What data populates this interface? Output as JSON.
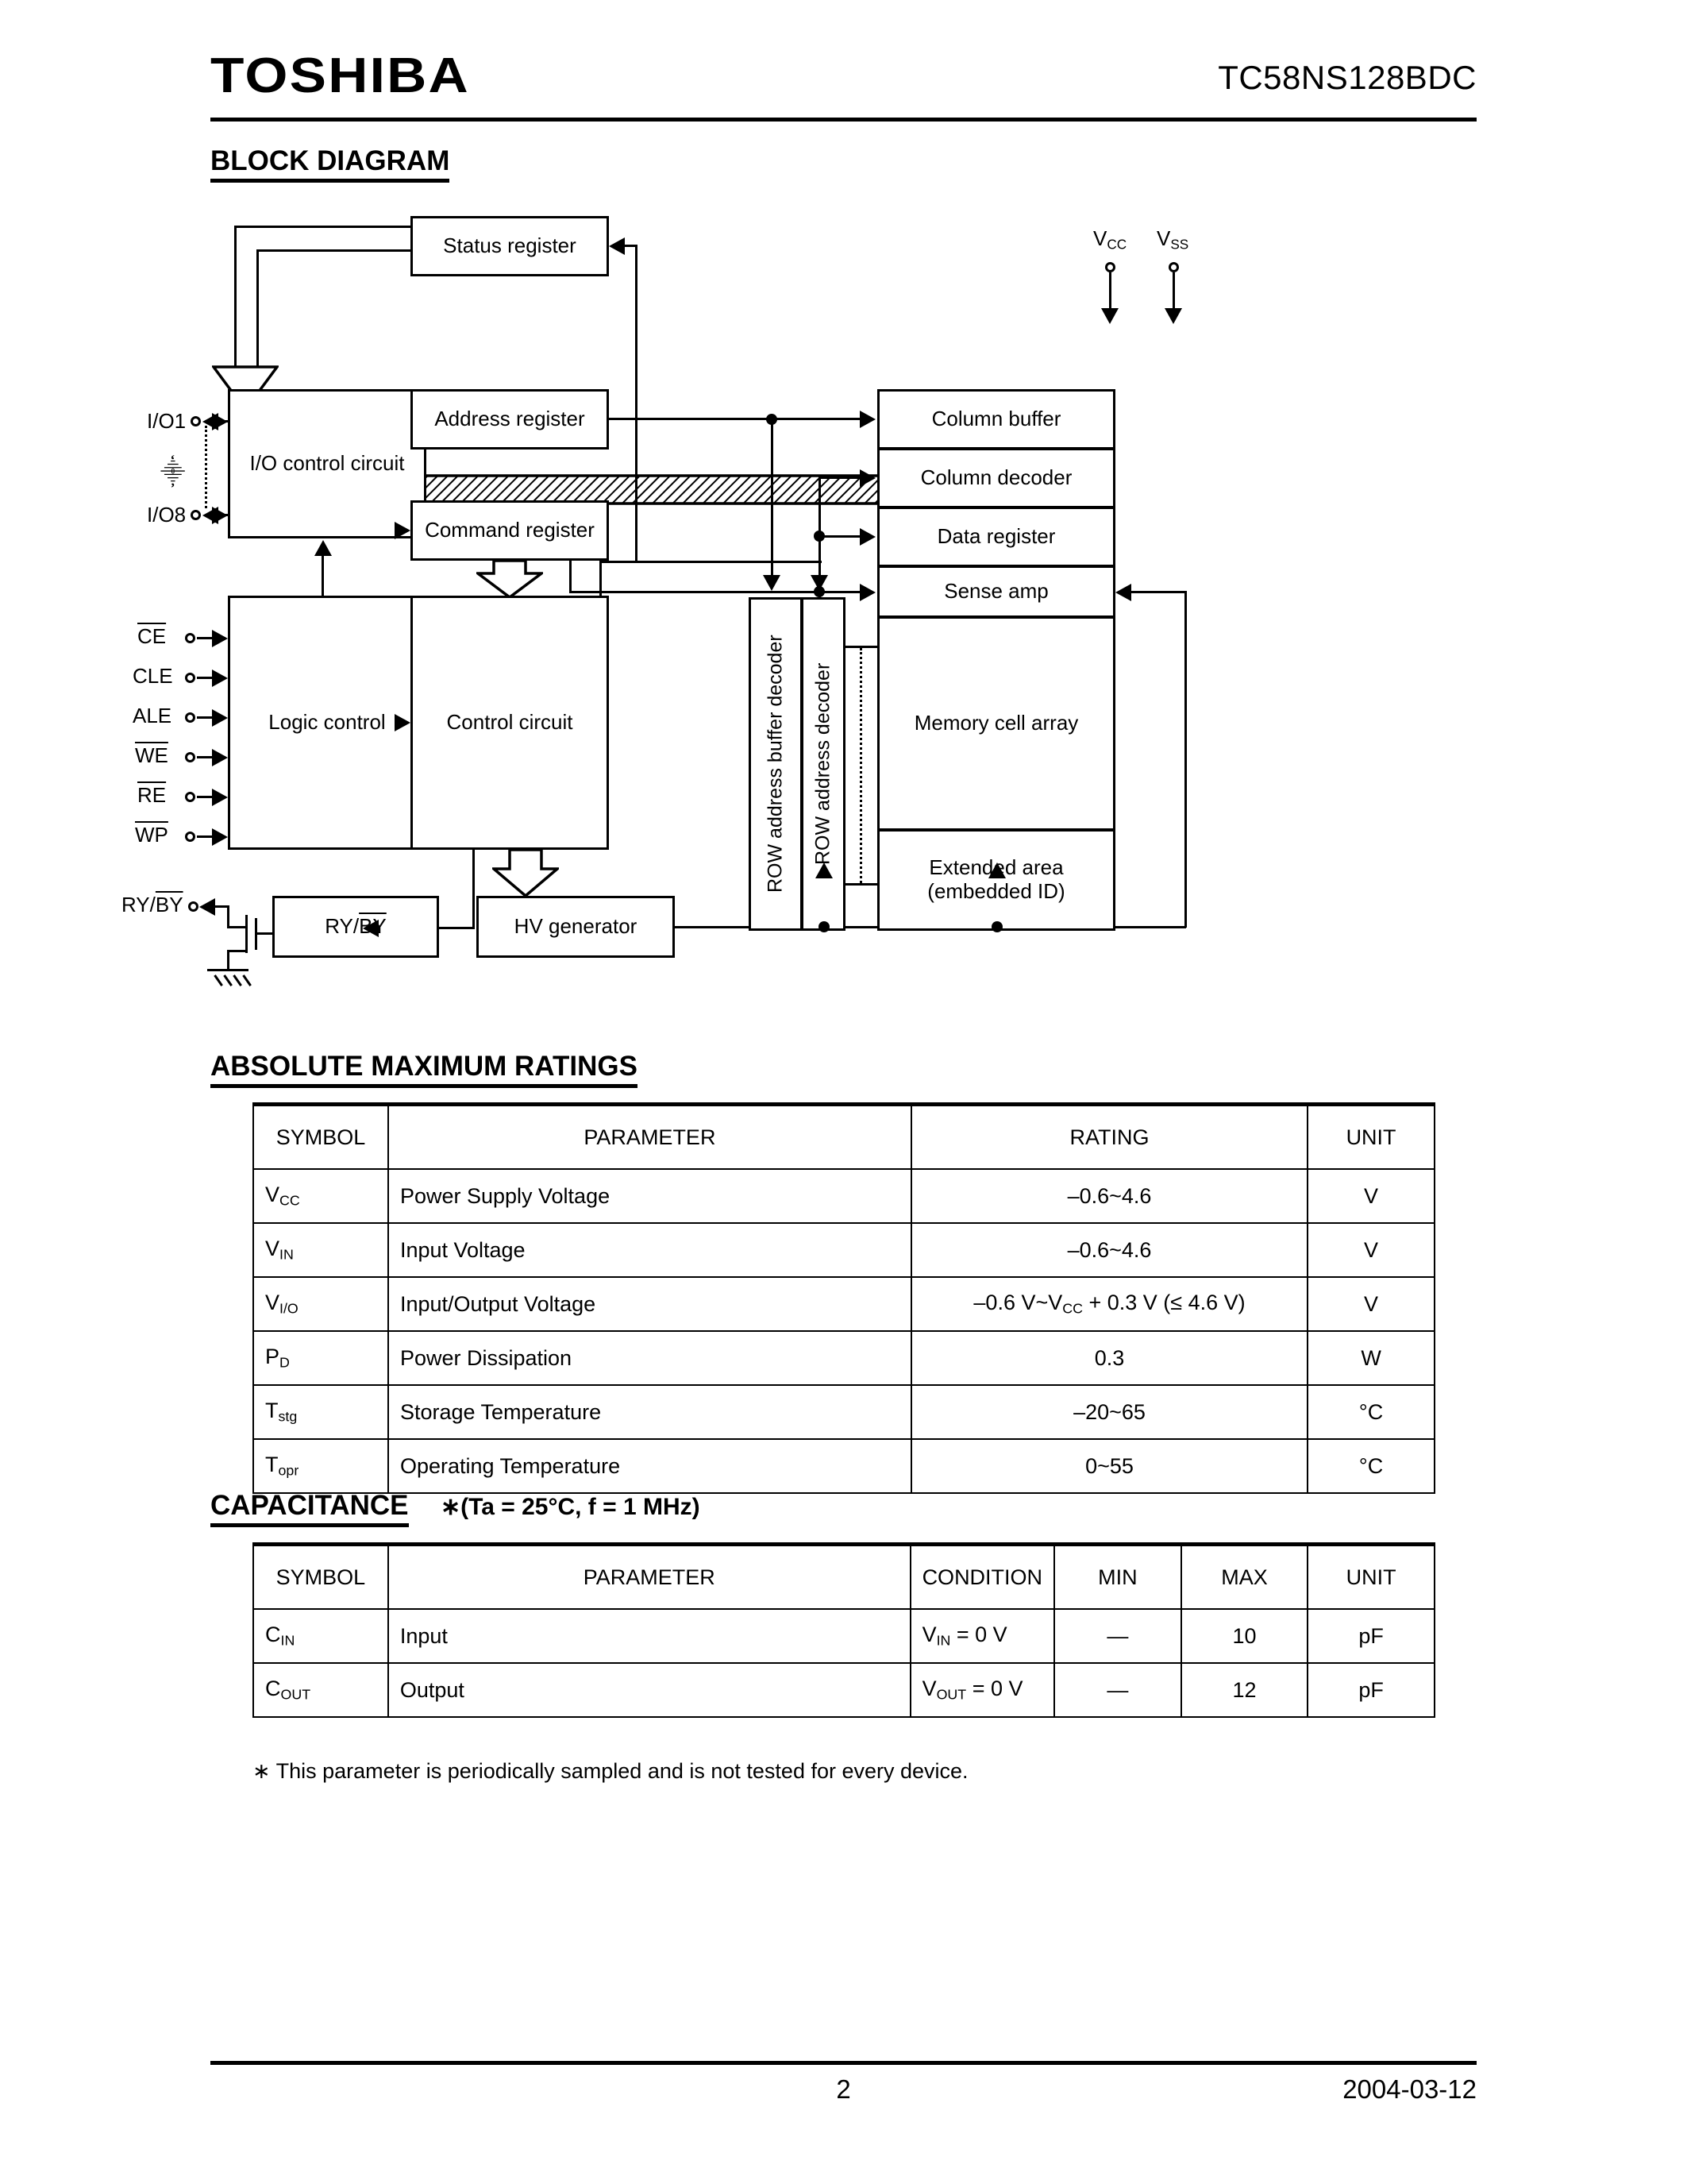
{
  "header": {
    "logo": "TOSHIBA",
    "part_number": "TC58NS128BDC"
  },
  "sections": {
    "block_diagram_title": "BLOCK DIAGRAM",
    "abs_max_title": "ABSOLUTE MAXIMUM RATINGS",
    "capacitance_title": "CAPACITANCE",
    "capacitance_note": "∗(Ta = 25°C, f = 1 MHz)"
  },
  "block_diagram": {
    "blocks": {
      "status_register": "Status register",
      "address_register": "Address register",
      "command_register": "Command register",
      "io_control_circuit": "I/O control circuit",
      "logic_control": "Logic control",
      "control_circuit": "Control circuit",
      "column_buffer": "Column buffer",
      "column_decoder": "Column decoder",
      "data_register": "Data register",
      "sense_amp": "Sense amp",
      "memory_cell_array": "Memory cell array",
      "extended_area_line1": "Extended area",
      "extended_area_line2": "(embedded ID)",
      "row_address_buffer_decoder": "ROW address buffer decoder",
      "row_address_decoder": "ROW address decoder",
      "hv_generator": "HV generator",
      "ry_by_block": "RY/BY"
    },
    "pins": {
      "io1": "I/O1",
      "io_ellipsis": "⸎",
      "io8": "I/O8",
      "ce": "CE",
      "cle": "CLE",
      "ale": "ALE",
      "we": "WE",
      "re": "RE",
      "wp": "WP",
      "ry_by": "RY/BY",
      "vcc": "VCC",
      "vss": "VSS"
    }
  },
  "abs_max_table": {
    "columns": [
      "SYMBOL",
      "PARAMETER",
      "RATING",
      "UNIT"
    ],
    "rows": [
      {
        "symbol_base": "V",
        "symbol_sub": "CC",
        "parameter": "Power Supply Voltage",
        "rating": "–0.6~4.6",
        "unit": "V"
      },
      {
        "symbol_base": "V",
        "symbol_sub": "IN",
        "parameter": "Input Voltage",
        "rating": "–0.6~4.6",
        "unit": "V"
      },
      {
        "symbol_base": "V",
        "symbol_sub": "I/O",
        "parameter": "Input/Output Voltage",
        "rating": "–0.6 V~VCC + 0.3 V (≤ 4.6 V)",
        "unit": "V"
      },
      {
        "symbol_base": "P",
        "symbol_sub": "D",
        "parameter": "Power Dissipation",
        "rating": "0.3",
        "unit": "W"
      },
      {
        "symbol_base": "T",
        "symbol_sub": "stg",
        "parameter": "Storage Temperature",
        "rating": "–20~65",
        "unit": "°C"
      },
      {
        "symbol_base": "T",
        "symbol_sub": "opr",
        "parameter": "Operating Temperature",
        "rating": "0~55",
        "unit": "°C"
      }
    ]
  },
  "capacitance_table": {
    "columns": [
      "SYMBOL",
      "PARAMETER",
      "CONDITION",
      "MIN",
      "MAX",
      "UNIT"
    ],
    "rows": [
      {
        "symbol_base": "C",
        "symbol_sub": "IN",
        "parameter": "Input",
        "cond_base": "V",
        "cond_sub": "IN",
        "cond_tail": " = 0 V",
        "min": "—",
        "max": "10",
        "unit": "pF"
      },
      {
        "symbol_base": "C",
        "symbol_sub": "OUT",
        "parameter": "Output",
        "cond_base": "V",
        "cond_sub": "OUT",
        "cond_tail": " = 0 V",
        "min": "—",
        "max": "12",
        "unit": "pF"
      }
    ]
  },
  "footnote": "∗ This parameter is periodically sampled and is not tested for every device.",
  "footer": {
    "page_number": "2",
    "date": "2004-03-12"
  }
}
